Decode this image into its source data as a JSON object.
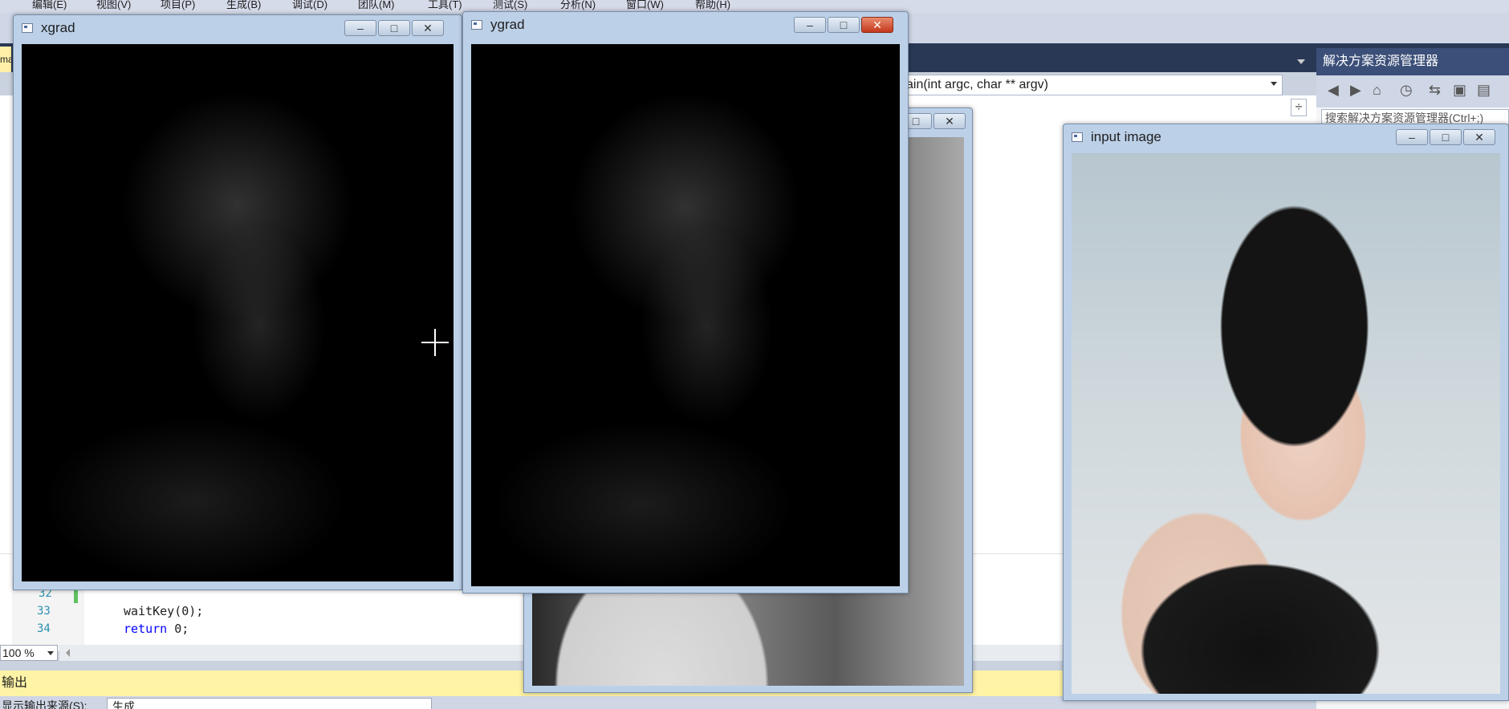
{
  "ide": {
    "menus": [
      "编辑(E)",
      "视图(V)",
      "项目(P)",
      "生成(B)",
      "调试(D)",
      "团队(M)",
      "工具(T)",
      "测试(S)",
      "分析(N)",
      "窗口(W)",
      "帮助(H)"
    ],
    "active_tab_fragment": "ma",
    "function_nav": "ain(int argc, char ** argv)",
    "code": {
      "line_numbers": [
        "32",
        "33",
        "34"
      ],
      "line_33": "waitKey(0);",
      "line_34_keyword": "return",
      "line_34_rest": " 0;"
    },
    "zoom": "100 %",
    "output_title": "输出",
    "output_source_label": "显示输出来源(S):",
    "output_source_value": "生成"
  },
  "solution_explorer": {
    "title": "解决方案资源管理器",
    "search_placeholder": "搜索解决方案资源管理器(Ctrl+;)"
  },
  "windows": {
    "xgrad": {
      "title": "xgrad"
    },
    "ygrad": {
      "title": "ygrad"
    },
    "input": {
      "title": "input image"
    }
  },
  "window_controls": {
    "minimize": "–",
    "maximize": "□",
    "close": "✕"
  },
  "colors": {
    "close_button_active": "#c4381d",
    "titlebar": "#bcd0e8",
    "output_header": "#fff3a6"
  }
}
